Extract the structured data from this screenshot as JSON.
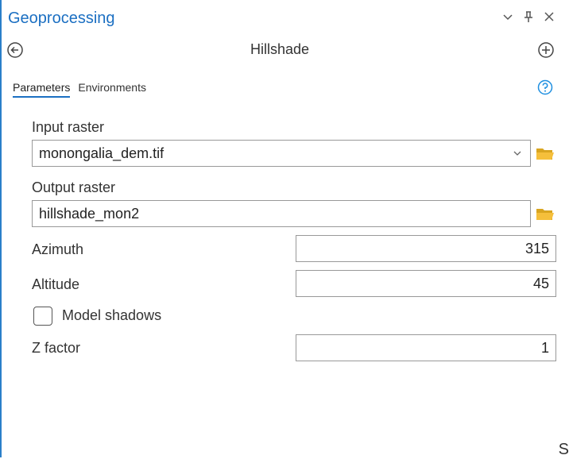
{
  "header": {
    "title": "Geoprocessing"
  },
  "tool": {
    "name": "Hillshade"
  },
  "tabs": [
    {
      "label": "Parameters"
    },
    {
      "label": "Environments"
    }
  ],
  "params": {
    "input_raster": {
      "label": "Input raster",
      "value": "monongalia_dem.tif"
    },
    "output_raster": {
      "label": "Output raster",
      "value": "hillshade_mon2"
    },
    "azimuth": {
      "label": "Azimuth",
      "value": "315"
    },
    "altitude": {
      "label": "Altitude",
      "value": "45"
    },
    "model_shadows": {
      "label": "Model shadows",
      "checked": false
    },
    "z_factor": {
      "label": "Z factor",
      "value": "1"
    }
  },
  "icons": {
    "menu": "chevron-down-icon",
    "pin": "pin-icon",
    "close": "close-icon",
    "back": "back-arrow-icon",
    "add": "plus-circle-icon",
    "help": "help-icon",
    "folder": "folder-icon"
  },
  "colors": {
    "accent": "#1b6fc2",
    "folder": "#f5bf3b",
    "help": "#1e8fe0"
  },
  "stray_text": "S"
}
